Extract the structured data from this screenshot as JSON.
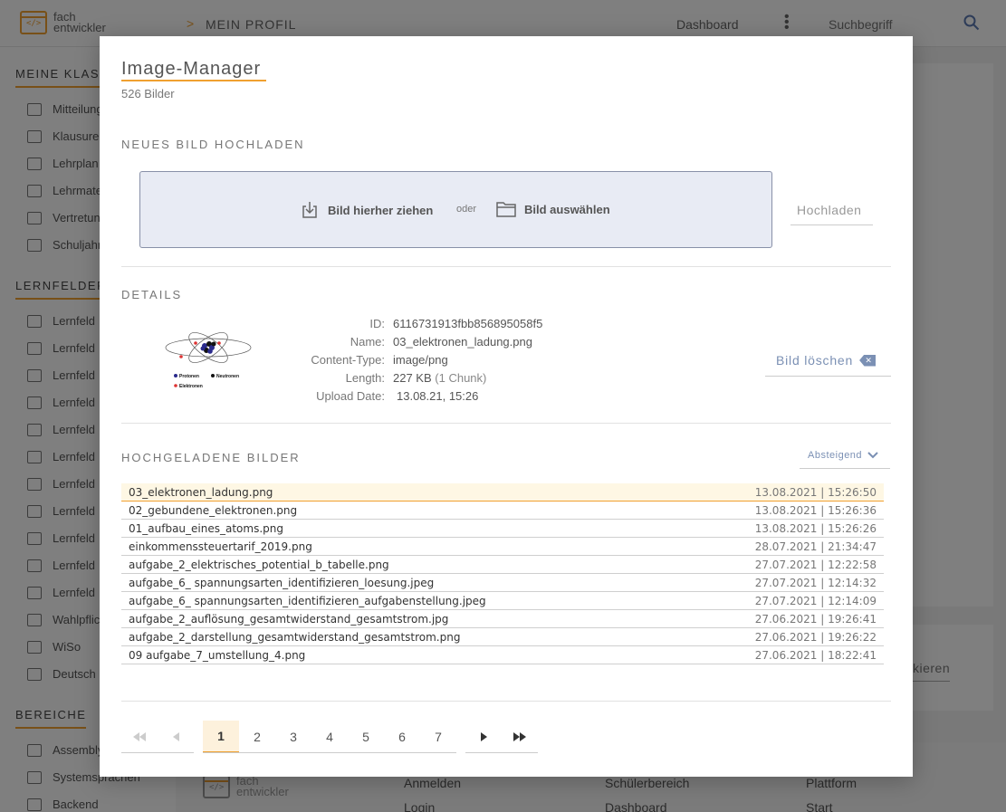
{
  "background": {
    "logo_line1": "fach",
    "logo_line2": "entwickler",
    "logo_glyph": "</>",
    "breadcrumb_arrow": ">",
    "breadcrumb": "MEIN PROFIL",
    "nav_dashboard": "Dashboard",
    "search_placeholder": "Suchbegriff",
    "sidebar": {
      "section_classes": "MEINE KLASSEN",
      "classes_items": [
        "Mitteilungen",
        "Klausuren",
        "Lehrplan",
        "Lehrmaterial",
        "Vertretung",
        "Schuljahr"
      ],
      "section_fields": "LERNFELDER",
      "field_items": [
        "Lernfeld",
        "Lernfeld",
        "Lernfeld",
        "Lernfeld",
        "Lernfeld",
        "Lernfeld",
        "Lernfeld",
        "Lernfeld",
        "Lernfeld",
        "Lernfeld",
        "Lernfeld",
        "Wahlpflicht",
        "WiSo",
        "Deutsch"
      ],
      "section_areas": "BEREICHE",
      "area_items": [
        "Assembly",
        "Systemsprachen",
        "Backend"
      ]
    },
    "card_button": "kieren",
    "footer": {
      "col1": "Anmelden",
      "col1b": "Login",
      "col2": "Schülerbereich",
      "col2b": "Dashboard",
      "col3": "Plattform",
      "col3b": "Start"
    }
  },
  "modal": {
    "title": "Image-Manager",
    "count": "526 Bilder",
    "upload_heading": "NEUES BILD HOCHLADEN",
    "drag_label": "Bild hierher ziehen",
    "or_label": "oder",
    "select_label": "Bild auswählen",
    "upload_button": "Hochladen",
    "details_heading": "DETAILS",
    "details": {
      "id_label": "ID:",
      "id_value": "6116731913fbb856895058f5",
      "name_label": "Name:",
      "name_value": "03_elektronen_ladung.png",
      "type_label": "Content-Type:",
      "type_value": "image/png",
      "length_label": "Length:",
      "length_value": "227 KB",
      "length_chunks": "(1 Chunk)",
      "date_label": "Upload Date:",
      "date_value": "13.08.21, 15:26"
    },
    "thumb_legend": {
      "protons": "Protonen",
      "neutrons": "Neutronen",
      "electrons": "Elektronen"
    },
    "delete_button": "Bild löschen",
    "uploaded_heading": "HOCHGELADENE BILDER",
    "sort_label": "Absteigend",
    "files": [
      {
        "name": "03_elektronen_ladung.png",
        "date": "13.08.2021 | 15:26:50"
      },
      {
        "name": "02_gebundene_elektronen.png",
        "date": "13.08.2021 | 15:26:36"
      },
      {
        "name": "01_aufbau_eines_atoms.png",
        "date": "13.08.2021 | 15:26:26"
      },
      {
        "name": "einkommenssteuertarif_2019.png",
        "date": "28.07.2021 | 21:34:47"
      },
      {
        "name": "aufgabe_2_elektrisches_potential_b_tabelle.png",
        "date": "27.07.2021 | 12:22:58"
      },
      {
        "name": "aufgabe_6_ spannungsarten_identifizieren_loesung.jpeg",
        "date": "27.07.2021 | 12:14:32"
      },
      {
        "name": "aufgabe_6_ spannungsarten_identifizieren_aufgabenstellung.jpeg",
        "date": "27.07.2021 | 12:14:09"
      },
      {
        "name": "aufgabe_2_auflösung_gesamtwiderstand_gesamtstrom.jpg",
        "date": "27.06.2021 | 19:26:41"
      },
      {
        "name": "aufgabe_2_darstellung_gesamtwiderstand_gesamtstrom.png",
        "date": "27.06.2021 | 19:26:22"
      },
      {
        "name": "09 aufgabe_7_umstellung_4.png",
        "date": "27.06.2021 | 18:22:41"
      }
    ],
    "pagination": {
      "pages": [
        "1",
        "2",
        "3",
        "4",
        "5",
        "6",
        "7"
      ],
      "current": "1"
    }
  },
  "colors": {
    "accent": "#f0a030",
    "link_blue": "#7b90b4",
    "dropzone_bg": "#e8ebf4"
  }
}
